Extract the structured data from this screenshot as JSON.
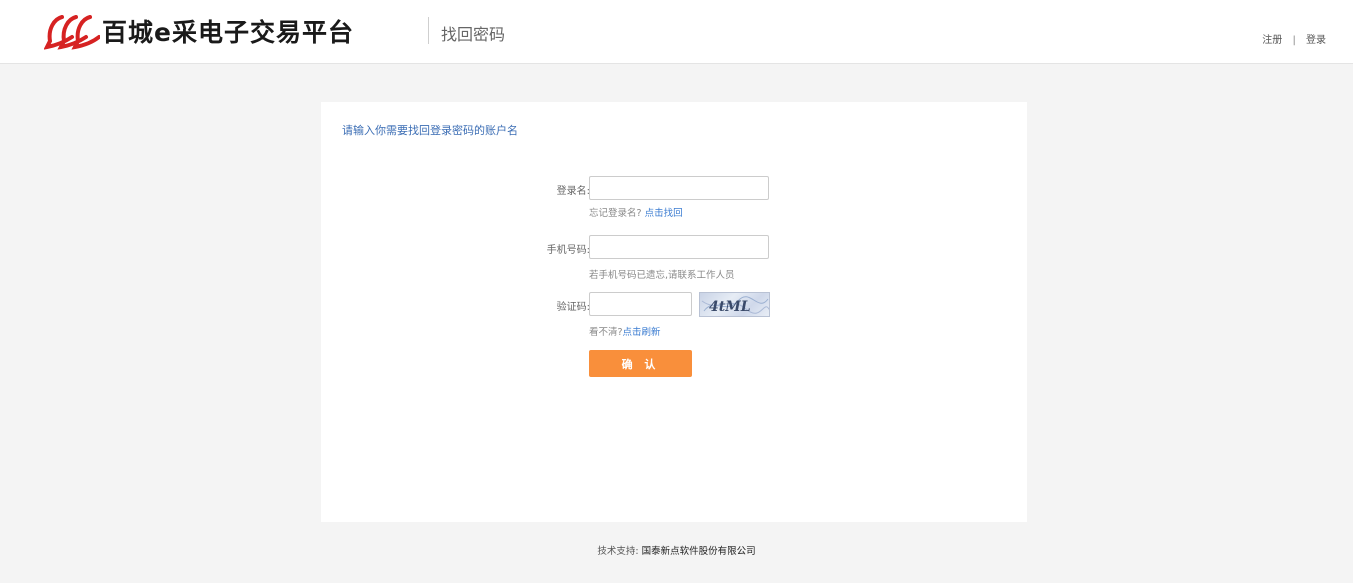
{
  "header": {
    "logo_text": "百城e采电子交易平台",
    "subtitle": "找回密码",
    "register_label": "注册",
    "separator": "|",
    "login_label": "登录",
    "brand_color": "#d62222"
  },
  "form": {
    "title": "请输入你需要找回登录密码的账户名",
    "login_name": {
      "label": "登录名:",
      "value": "",
      "hint_prefix": "忘记登录名?",
      "hint_link": "点击找回"
    },
    "phone": {
      "label": "手机号码:",
      "value": "",
      "hint": "若手机号码已遗忘,请联系工作人员"
    },
    "captcha": {
      "label": "验证码:",
      "value": "",
      "image_text": "4tML",
      "hint_prefix": "看不清?",
      "hint_link": "点击刷新"
    },
    "confirm_label": "确 认",
    "confirm_color": "#f98f3b"
  },
  "footer": {
    "prefix": "技术支持:",
    "company": "国泰新点软件股份有限公司"
  }
}
